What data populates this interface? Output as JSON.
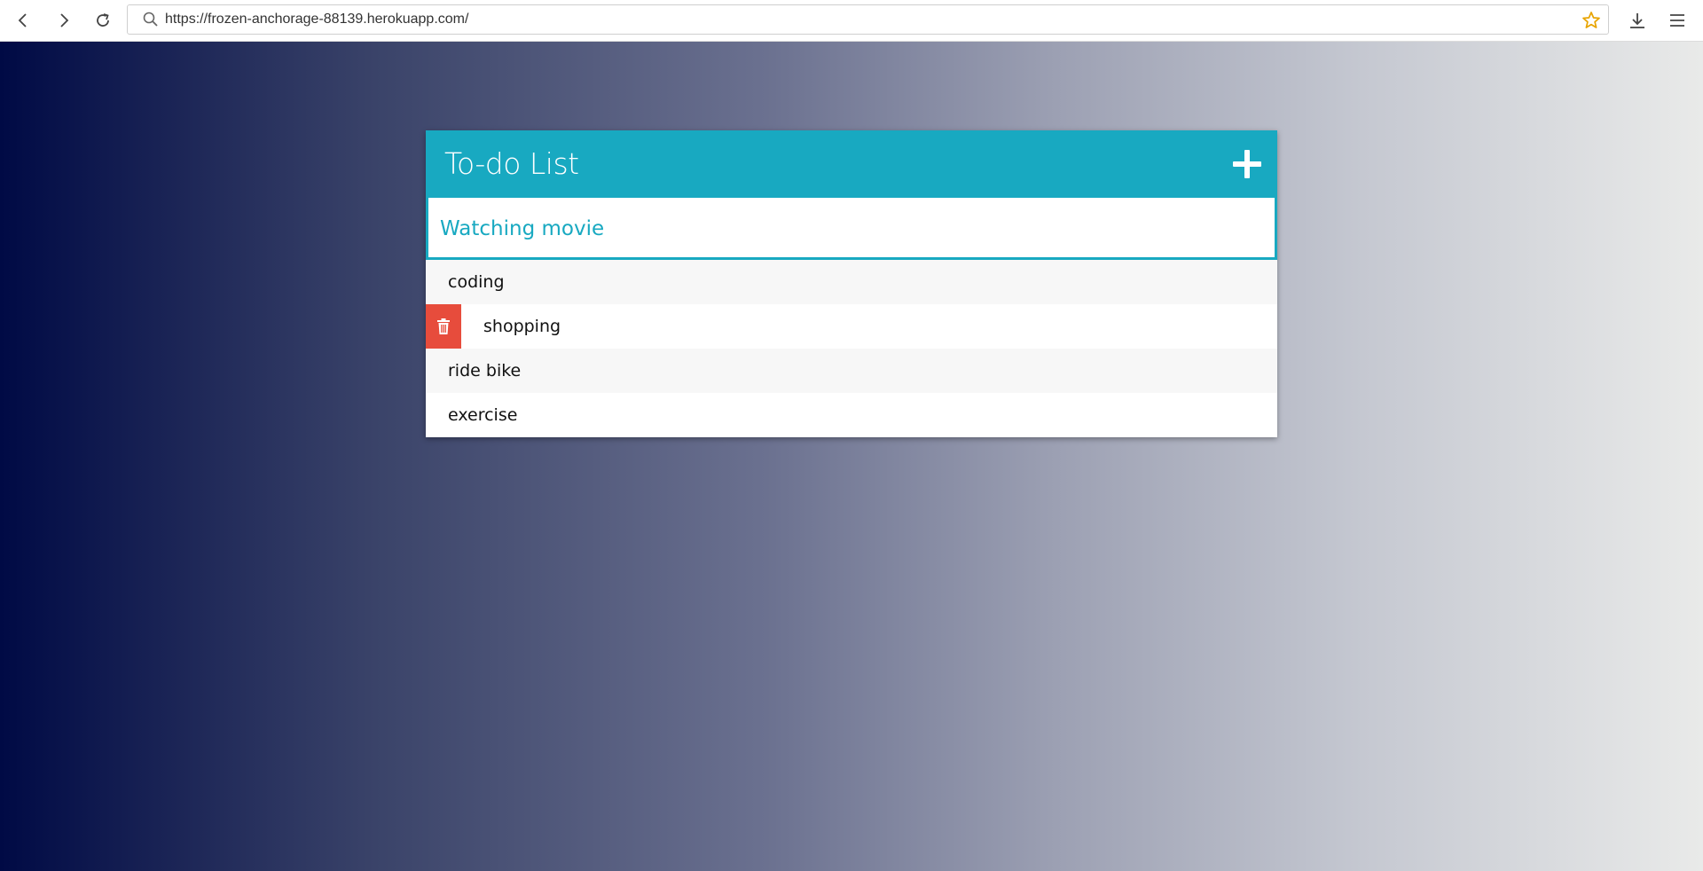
{
  "browser": {
    "url": "https://frozen-anchorage-88139.herokuapp.com/"
  },
  "app": {
    "title": "To-do List",
    "input_value": "Watching movie",
    "todos": [
      {
        "text": "coding",
        "show_delete": false
      },
      {
        "text": "shopping",
        "show_delete": true
      },
      {
        "text": "ride bike",
        "show_delete": false
      },
      {
        "text": "exercise",
        "show_delete": false
      }
    ]
  },
  "colors": {
    "accent": "#18a9c1",
    "delete": "#e74c3c",
    "gradient_start": "#000a45",
    "gradient_end": "#e9eae9"
  },
  "icons": {
    "back": "back-arrow-icon",
    "forward": "forward-arrow-icon",
    "reload": "reload-icon",
    "search": "search-icon",
    "bookmark": "star-icon",
    "download": "download-icon",
    "menu": "hamburger-menu-icon",
    "add": "plus-icon",
    "delete": "trash-icon"
  }
}
